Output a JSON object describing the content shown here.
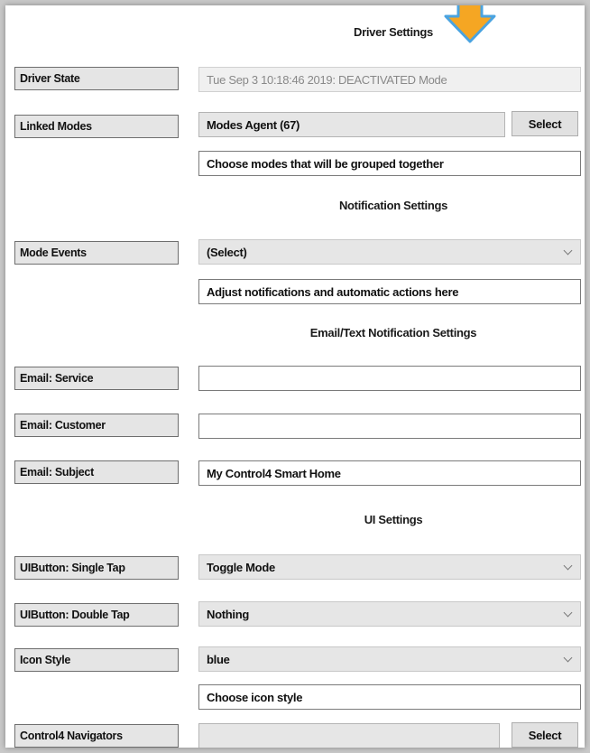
{
  "sections": {
    "driver": "Driver Settings",
    "notification": "Notification Settings",
    "email": "Email/Text Notification Settings",
    "ui": "UI Settings"
  },
  "labels": {
    "driver_state": "Driver State",
    "linked_modes": "Linked Modes",
    "mode_events": "Mode Events",
    "email_service": "Email: Service",
    "email_customer": "Email: Customer",
    "email_subject": "Email: Subject",
    "single_tap": "UIButton: Single Tap",
    "double_tap": "UIButton: Double Tap",
    "icon_style": "Icon Style",
    "navigators": "Control4 Navigators"
  },
  "values": {
    "driver_state": "Tue Sep  3 10:18:46 2019: DEACTIVATED Mode",
    "linked_modes": "Modes Agent (67)",
    "linked_modes_hint": "Choose modes that will be grouped together",
    "mode_events": "(Select)",
    "mode_events_hint": "Adjust notifications and automatic actions here",
    "email_service": "",
    "email_customer": "",
    "email_subject": "My Control4 Smart Home",
    "single_tap": "Toggle Mode",
    "double_tap": "Nothing",
    "icon_style": "blue",
    "icon_style_hint": "Choose icon style",
    "navigators": ""
  },
  "buttons": {
    "select_linked": "Select",
    "select_navigators": "Select"
  },
  "colors": {
    "arrow": "#f5a623",
    "arrow_outline": "#4aa3e0"
  }
}
